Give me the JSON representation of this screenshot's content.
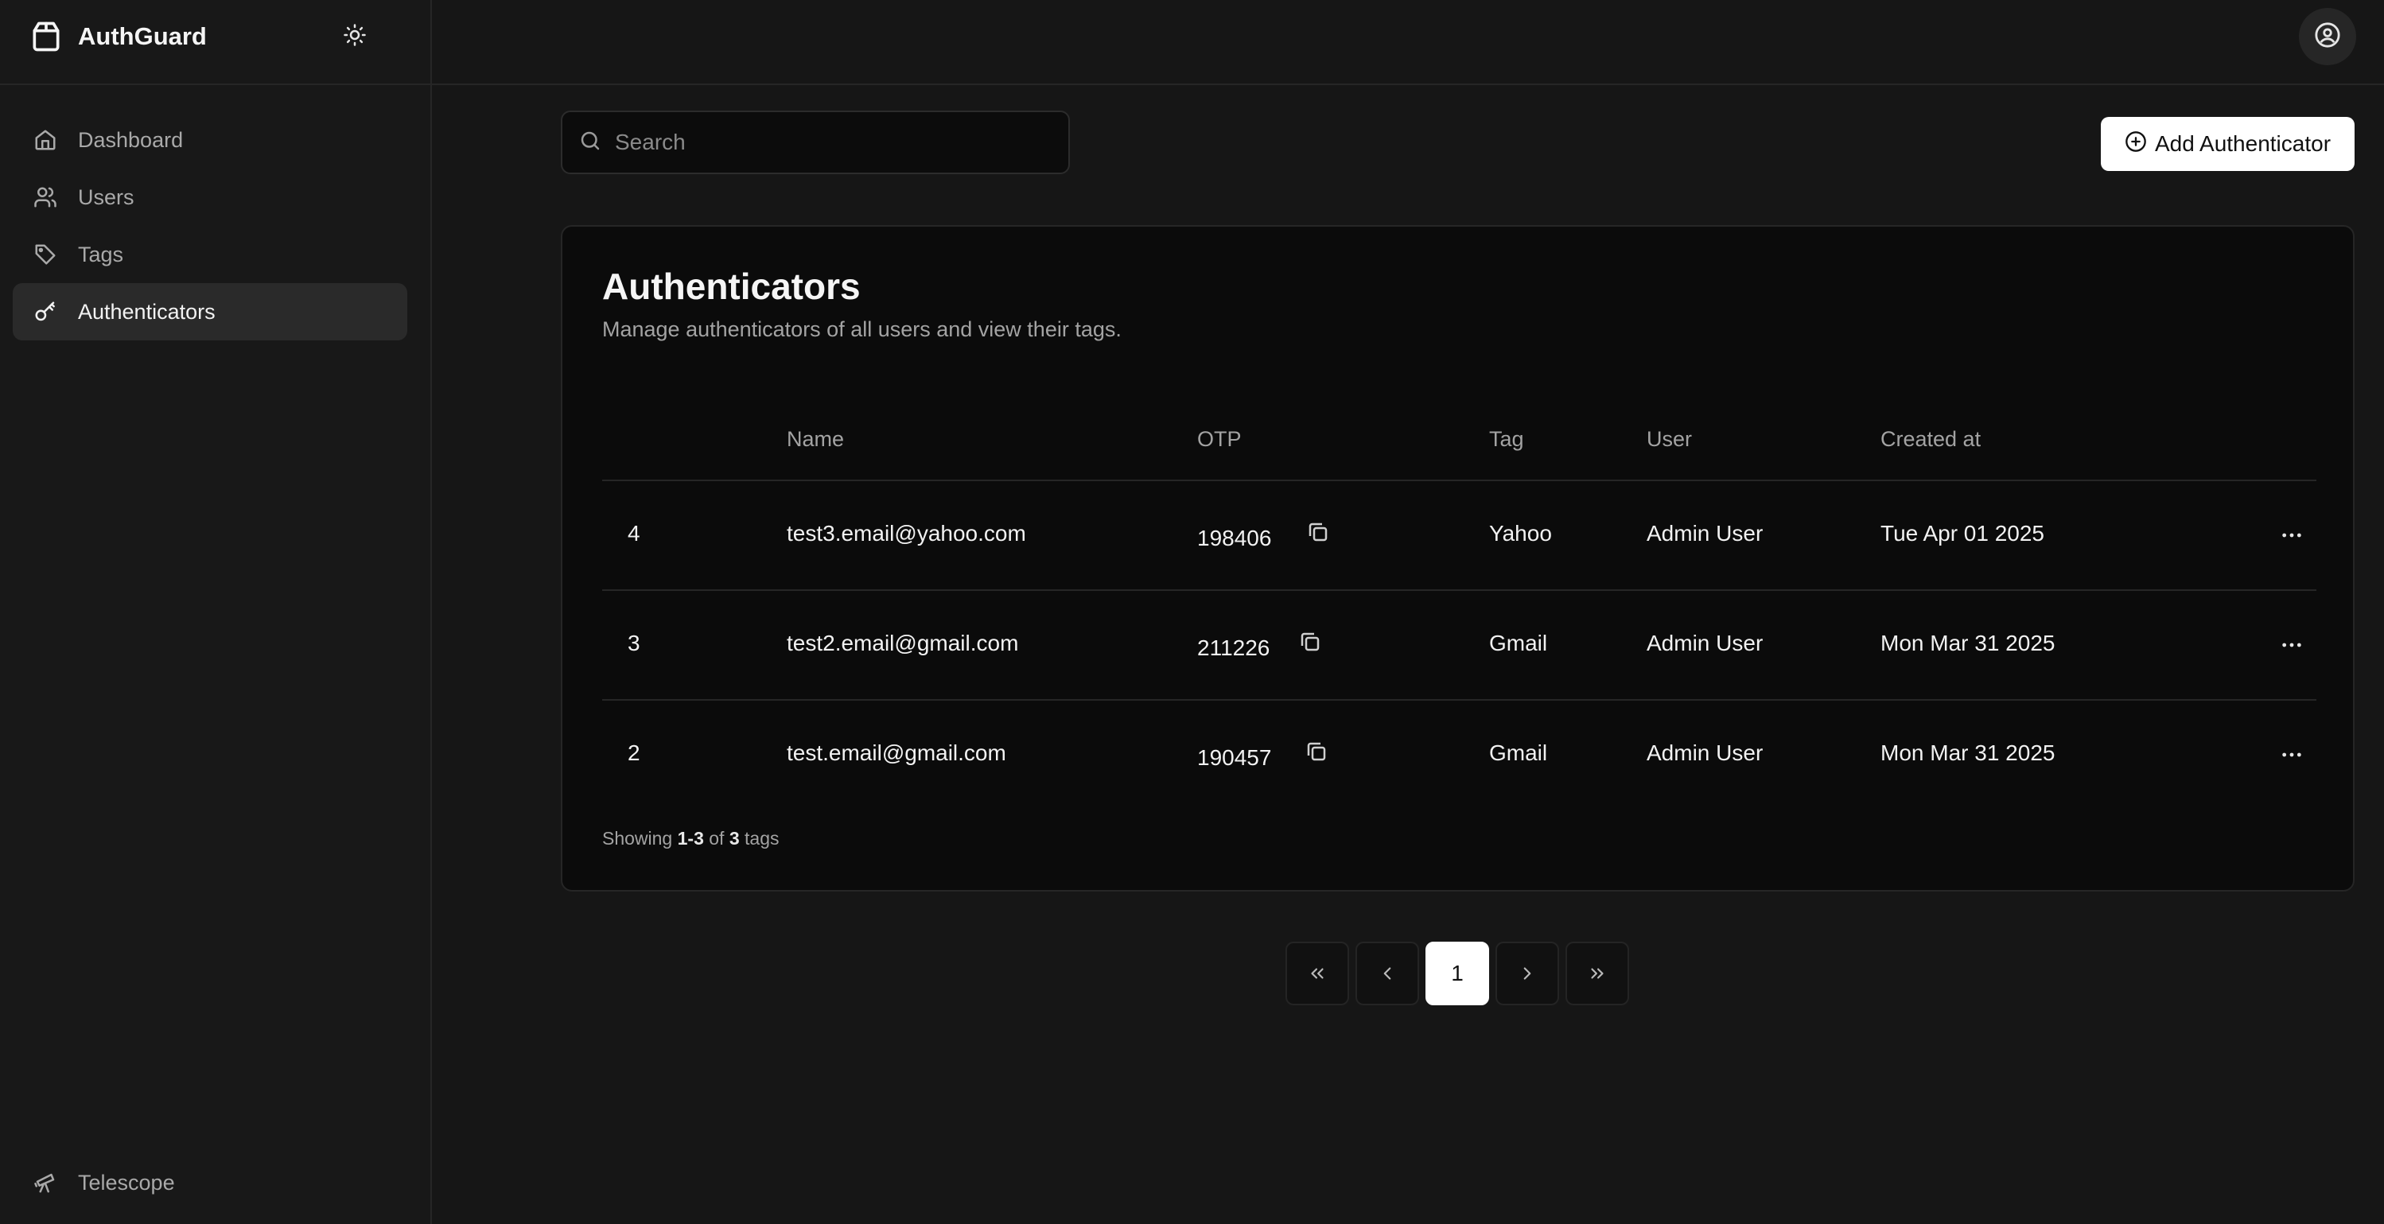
{
  "app": {
    "name": "AuthGuard"
  },
  "sidebar": {
    "items": [
      {
        "label": "Dashboard",
        "icon": "home-icon",
        "active": false
      },
      {
        "label": "Users",
        "icon": "users-icon",
        "active": false
      },
      {
        "label": "Tags",
        "icon": "tag-icon",
        "active": false
      },
      {
        "label": "Authenticators",
        "icon": "key-icon",
        "active": true
      }
    ],
    "footer_item": {
      "label": "Telescope",
      "icon": "telescope-icon"
    }
  },
  "search": {
    "placeholder": "Search",
    "value": ""
  },
  "toolbar": {
    "add_label": "Add Authenticator"
  },
  "card": {
    "title": "Authenticators",
    "description": "Manage authenticators of all users and view their tags."
  },
  "table": {
    "columns": [
      "",
      "Name",
      "OTP",
      "Tag",
      "User",
      "Created at"
    ],
    "rows": [
      {
        "id": "4",
        "name": "test3.email@yahoo.com",
        "otp": "198406",
        "tag": "Yahoo",
        "user": "Admin User",
        "created": "Tue Apr 01 2025"
      },
      {
        "id": "3",
        "name": "test2.email@gmail.com",
        "otp": "211226",
        "tag": "Gmail",
        "user": "Admin User",
        "created": "Mon Mar 31 2025"
      },
      {
        "id": "2",
        "name": "test.email@gmail.com",
        "otp": "190457",
        "tag": "Gmail",
        "user": "Admin User",
        "created": "Mon Mar 31 2025"
      }
    ]
  },
  "footer": {
    "prefix": "Showing",
    "range": "1-3",
    "of": "of",
    "total": "3",
    "suffix": "tags"
  },
  "pagination": {
    "current": "1"
  },
  "colors": {
    "background": "#161616",
    "card": "#0b0b0b",
    "accent": "#ffffff",
    "muted_text": "#a3a3a3"
  }
}
